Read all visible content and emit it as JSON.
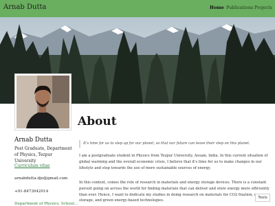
{
  "navbar": {
    "brand": "Arnab Dutta",
    "links": [
      "Home",
      "Publications",
      "Projects"
    ],
    "active": "Home"
  },
  "sidebar": {
    "name": "Arnab Dutta",
    "role": "Post Graduate, Department of Physics, Tezpur University",
    "cv_link": "Curriculum vitae",
    "email": "arnabdutta.djn@gmail.com",
    "phone": "+91-8473042014",
    "dept_link": "Department of Physics, School..."
  },
  "main": {
    "title": "About",
    "quote": "It's time for us to step up for our planet, so that our future can leave their step on this planet.",
    "paragraph1": "I am a postgraduate student in Physics from Tezpur University, Assam, India.  In this current situation of global warming and the overall economic crisis, I believe that it's time for us to make changes in our lifestyle and step towards the use of more sustainable sources of energy.",
    "paragraph2": "In this context, comes the role of research in materials and energy storage devices. There is a constant pursuit going on across the world for finding materials that can deliver and store energy more efficiently than ever. Hence, I want to dedicate my studies in doing research on materials for CO2 fixation, energy storage, and green energy-based technologies."
  },
  "tools_button": "Tools",
  "colors": {
    "navbar_bg": "#6aae5f",
    "link": "#2f7a3a"
  }
}
